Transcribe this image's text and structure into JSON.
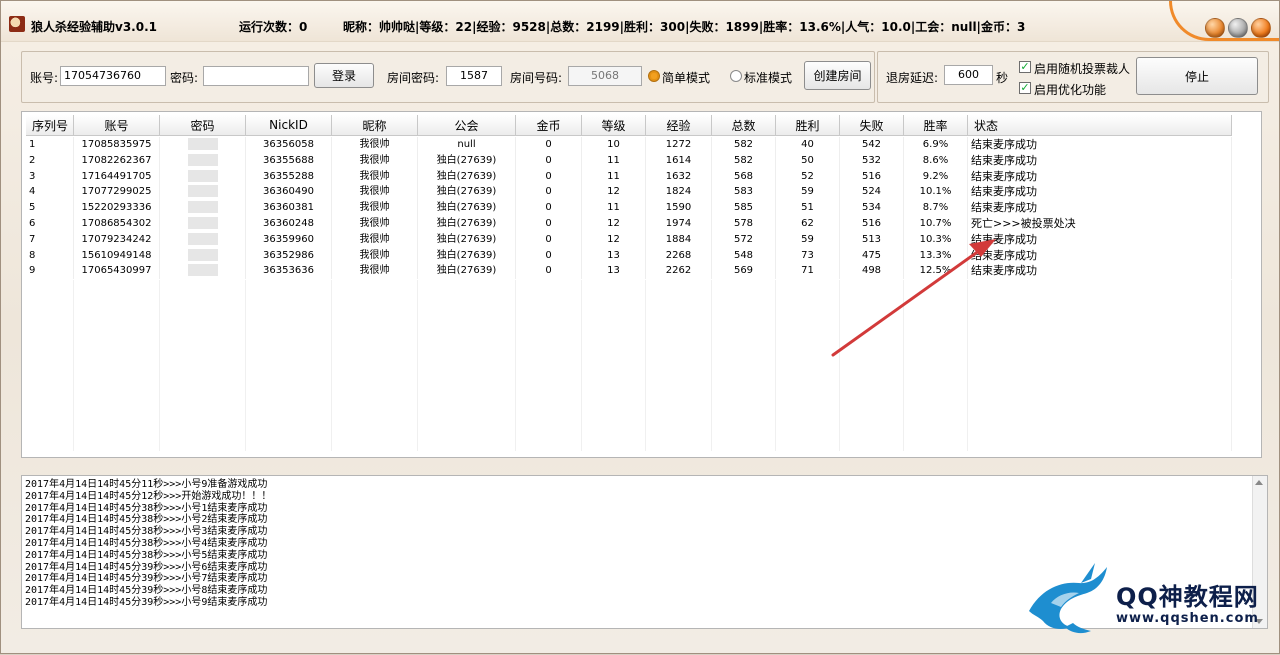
{
  "titlebar": {
    "app_title": "狼人杀经验辅助v3.0.1",
    "run_count": "运行次数：0",
    "status": "昵称：帅帅哒|等级：22|经验：9528|总数：2199|胜利：300|失败：1899|胜率：13.6%|人气：10.0|工会：null|金币：3"
  },
  "login": {
    "account_label": "账号:",
    "account_value": "17054736760",
    "password_label": "密码:",
    "password_value": "",
    "login_button": "登录",
    "room_password_label": "房间密码:",
    "room_password_value": "1587",
    "room_number_label": "房间号码:",
    "room_number_value": "5068",
    "simple_mode": "简单模式",
    "standard_mode": "标准模式",
    "create_room_button": "创建房间"
  },
  "settings": {
    "exit_delay_label": "退房延迟:",
    "exit_delay_value": "600",
    "seconds_unit": "秒",
    "random_vote_label": "启用随机投票裁人",
    "random_vote_checked": true,
    "optimize_label": "启用优化功能",
    "optimize_checked": true,
    "stop_button": "停止"
  },
  "table": {
    "columns": [
      "序列号",
      "账号",
      "密码",
      "NickID",
      "昵称",
      "公会",
      "金币",
      "等级",
      "经验",
      "总数",
      "胜利",
      "失败",
      "胜率",
      "状态"
    ],
    "rows": [
      [
        "1",
        "17085835975",
        "",
        "36356058",
        "我很帅",
        "null",
        "0",
        "10",
        "1272",
        "582",
        "40",
        "542",
        "6.9%",
        "结束麦序成功"
      ],
      [
        "2",
        "17082262367",
        "",
        "36355688",
        "我很帅",
        "独白(27639)",
        "0",
        "11",
        "1614",
        "582",
        "50",
        "532",
        "8.6%",
        "结束麦序成功"
      ],
      [
        "3",
        "17164491705",
        "",
        "36355288",
        "我很帅",
        "独白(27639)",
        "0",
        "11",
        "1632",
        "568",
        "52",
        "516",
        "9.2%",
        "结束麦序成功"
      ],
      [
        "4",
        "17077299025",
        "",
        "36360490",
        "我很帅",
        "独白(27639)",
        "0",
        "12",
        "1824",
        "583",
        "59",
        "524",
        "10.1%",
        "结束麦序成功"
      ],
      [
        "5",
        "15220293336",
        "",
        "36360381",
        "我很帅",
        "独白(27639)",
        "0",
        "11",
        "1590",
        "585",
        "51",
        "534",
        "8.7%",
        "结束麦序成功"
      ],
      [
        "6",
        "17086854302",
        "",
        "36360248",
        "我很帅",
        "独白(27639)",
        "0",
        "12",
        "1974",
        "578",
        "62",
        "516",
        "10.7%",
        "死亡>>>被投票处决"
      ],
      [
        "7",
        "17079234242",
        "",
        "36359960",
        "我很帅",
        "独白(27639)",
        "0",
        "12",
        "1884",
        "572",
        "59",
        "513",
        "10.3%",
        "结束麦序成功"
      ],
      [
        "8",
        "15610949148",
        "",
        "36352986",
        "我很帅",
        "独白(27639)",
        "0",
        "13",
        "2268",
        "548",
        "73",
        "475",
        "13.3%",
        "结束麦序成功"
      ],
      [
        "9",
        "17065430997",
        "",
        "36353636",
        "我很帅",
        "独白(27639)",
        "0",
        "13",
        "2262",
        "569",
        "71",
        "498",
        "12.5%",
        "结束麦序成功"
      ]
    ]
  },
  "log": {
    "lines": [
      "2017年4月14日14时45分11秒>>>小号9准备游戏成功",
      "2017年4月14日14时45分12秒>>>开始游戏成功！！！",
      "2017年4月14日14时45分38秒>>>小号1结束麦序成功",
      "2017年4月14日14时45分38秒>>>小号2结束麦序成功",
      "2017年4月14日14时45分38秒>>>小号3结束麦序成功",
      "2017年4月14日14时45分38秒>>>小号4结束麦序成功",
      "2017年4月14日14时45分38秒>>>小号5结束麦序成功",
      "2017年4月14日14时45分39秒>>>小号6结束麦序成功",
      "2017年4月14日14时45分39秒>>>小号7结束麦序成功",
      "2017年4月14日14时45分39秒>>>小号8结束麦序成功",
      "2017年4月14日14时45分39秒>>>小号9结束麦序成功"
    ]
  },
  "watermark": {
    "name": "QQ神教程网",
    "url": "www.qqshen.com"
  },
  "colors": {
    "accent_orange": "#f08a2a",
    "arrow_red": "#d23a3a",
    "watermark_blue": "#1e8ed0"
  }
}
